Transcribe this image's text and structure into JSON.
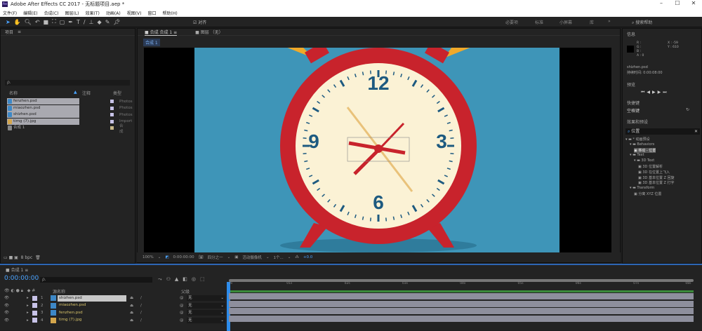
{
  "window": {
    "title": "Adobe After Effects CC 2017 - 无标题项目.aep *",
    "minimize": "–",
    "maximize": "☐",
    "close": "✕"
  },
  "menu": [
    "文件(F)",
    "编辑(E)",
    "合成(C)",
    "图层(L)",
    "效果(T)",
    "动画(A)",
    "视图(V)",
    "窗口",
    "帮助(H)"
  ],
  "toolbar": {
    "align": "对齐",
    "workspaces": [
      "必要项",
      "标准",
      "小屏幕",
      "库"
    ],
    "more": "»",
    "search_placeholder": "搜索帮助"
  },
  "project": {
    "title": "项目",
    "search_placeholder": "ρ.",
    "columns": {
      "name": "名称",
      "comment": "注释",
      "type": "类型"
    },
    "items": [
      {
        "name": "fenzhen.psd",
        "type": "Photos",
        "kind": "psd"
      },
      {
        "name": "miaozhen.psd",
        "type": "Photos",
        "kind": "psd"
      },
      {
        "name": "shizhen.psd",
        "type": "Photos",
        "kind": "psd"
      },
      {
        "name": "timg (7).jpg",
        "type": "Import",
        "kind": "jpg"
      },
      {
        "name": "合成 1",
        "type": "合成",
        "kind": "comp"
      }
    ],
    "bpc": "8 bpc"
  },
  "viewer": {
    "tab": "合成 合成 1",
    "layer_tab": "图层 （无）",
    "comp_label": "合成 1",
    "zoom": "100%",
    "timecode": "0:00:00:00",
    "resolution": "四分之一",
    "camera": "活动摄像机",
    "views": "1个...",
    "exposure": "+0.0"
  },
  "clock": {
    "numbers": [
      "12",
      "3",
      "6",
      "9"
    ]
  },
  "info": {
    "title": "信息",
    "r": "R :",
    "g": "G :",
    "b": "B :",
    "a": "A : 0",
    "x": "X : -59",
    "y": "Y : 610",
    "file": "shizhen.psd",
    "duration": "持续时间: 0:00:08:00"
  },
  "preview": {
    "title": "预览"
  },
  "shortcut": {
    "title": "快捷键",
    "value": "空格键"
  },
  "effects": {
    "title": "效果和预设",
    "search": "位置",
    "tree": [
      {
        "label": "* 动画预设",
        "level": 0
      },
      {
        "label": "Behaviors",
        "level": 1
      },
      {
        "label": "移动 - 位置",
        "level": 2,
        "selected": true
      },
      {
        "label": "Text",
        "level": 1
      },
      {
        "label": "3D Text",
        "level": 2
      },
      {
        "label": "3D 位置解析",
        "level": 3
      },
      {
        "label": "3D 在位置上飞入",
        "level": 3
      },
      {
        "label": "3D 基本位置 Z 回旋",
        "level": 3
      },
      {
        "label": "3D 基本位置 Z 打字",
        "level": 3
      },
      {
        "label": "Transform",
        "level": 1
      },
      {
        "label": "分离 XYZ 位置",
        "level": 2
      }
    ]
  },
  "timeline": {
    "tab": "合成 1",
    "timecode": "0:00:00:00",
    "search_placeholder": "ρ.",
    "col_source": "源名称",
    "col_parent": "父级",
    "ruler": [
      "0s",
      "01s",
      "02s",
      "03s",
      "04s",
      "05s",
      "06s",
      "07s",
      "08s"
    ],
    "layers": [
      {
        "num": "1",
        "name": "shizhen.psd",
        "parent": "无"
      },
      {
        "num": "2",
        "name": "miaozhen.psd",
        "parent": "无"
      },
      {
        "num": "3",
        "name": "fenzhen.psd",
        "parent": "无"
      },
      {
        "num": "4",
        "name": "timg (7).jpg",
        "parent": "无"
      }
    ]
  },
  "colors": {
    "accent": "#2d8ceb",
    "clock_red": "#c8232c",
    "clock_face": "#fbf2d5",
    "sky": "#3e95b8"
  }
}
